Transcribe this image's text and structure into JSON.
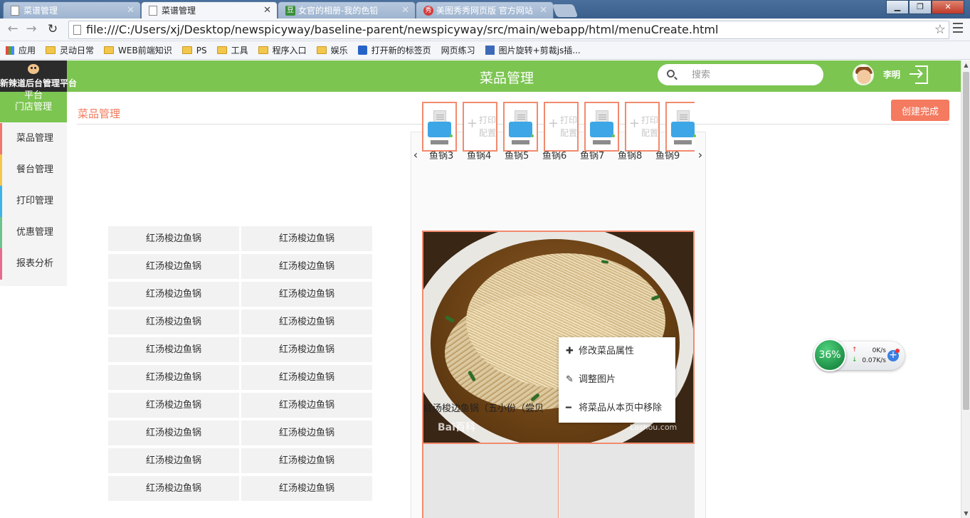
{
  "browser": {
    "tabs": [
      {
        "title": "菜谱管理",
        "icon": "page-icon"
      },
      {
        "title": "菜谱管理",
        "icon": "page-icon",
        "active": true
      },
      {
        "title": "女官的相册-我的色铅",
        "icon": "douban-icon"
      },
      {
        "title": "美图秀秀网页版 官方网站",
        "icon": "meitu-icon"
      }
    ],
    "close_glyph": "✕",
    "url": "file:///C:/Users/xj/Desktop/newspicyway/baseline-parent/newspicyway/src/main/webapp/html/menuCreate.html",
    "bookmarks": [
      {
        "label": "应用",
        "icon": "apps-icon"
      },
      {
        "label": "灵动日常",
        "icon": "folder-icon"
      },
      {
        "label": "WEB前端知识",
        "icon": "folder-icon"
      },
      {
        "label": "PS",
        "icon": "folder-icon"
      },
      {
        "label": "工具",
        "icon": "folder-icon"
      },
      {
        "label": "程序入口",
        "icon": "folder-icon"
      },
      {
        "label": "娱乐",
        "icon": "folder-icon"
      },
      {
        "label": "打开新的标签页",
        "icon": "paw-icon"
      },
      {
        "label": "网页练习",
        "icon": "page-icon"
      },
      {
        "label": "图片旋转+剪裁js插...",
        "icon": "image-icon"
      }
    ]
  },
  "app": {
    "brand": "新辣道后台管理平台",
    "title": "菜品管理",
    "search_placeholder": "搜索",
    "user": "李明"
  },
  "sidebar": {
    "active": [
      "平台",
      "门店管理"
    ],
    "items": [
      "菜品管理",
      "餐台管理",
      "打印管理",
      "优惠管理",
      "报表分析"
    ],
    "item_colors": [
      "#f0766b",
      "#f5c64a",
      "#3bb3e8",
      "#6bc48a",
      "#e86b8f"
    ]
  },
  "content": {
    "section_title": "菜品管理",
    "create_button": "创建完成"
  },
  "dishes": [
    "红汤梭边鱼锅",
    "红汤梭边鱼锅",
    "红汤梭边鱼锅",
    "红汤梭边鱼锅",
    "红汤梭边鱼锅",
    "红汤梭边鱼锅",
    "红汤梭边鱼锅",
    "红汤梭边鱼锅",
    "红汤梭边鱼锅",
    "红汤梭边鱼锅",
    "红汤梭边鱼锅",
    "红汤梭边鱼锅",
    "红汤梭边鱼锅",
    "红汤梭边鱼锅",
    "红汤梭边鱼锅",
    "红汤梭边鱼锅",
    "红汤梭边鱼锅",
    "红汤梭边鱼锅",
    "红汤梭边鱼锅",
    "红汤梭边鱼锅"
  ],
  "categories": [
    "鱼锅3",
    "鱼锅4",
    "鱼锅5",
    "鱼锅6",
    "鱼锅7",
    "鱼锅8",
    "鱼锅9"
  ],
  "print_config": {
    "add_label_1": "打印",
    "add_label_2": "配置",
    "slots": [
      "printer",
      "add",
      "printer",
      "add",
      "printer",
      "add",
      "printer"
    ]
  },
  "photo": {
    "caption": "红汤梭边鱼锅（五小份（尝贝",
    "watermark_left": "Bai百科",
    "watermark_right": "Lashou.com"
  },
  "context_menu": [
    {
      "label": "修改菜品属性",
      "icon": "plus-icon",
      "glyph": "✚"
    },
    {
      "label": "调整图片",
      "icon": "edit-icon",
      "glyph": "✎"
    },
    {
      "label": "将菜品从本页中移除",
      "icon": "minus-icon",
      "glyph": "━"
    }
  ],
  "net_widget": {
    "percent": "36%",
    "up": "0K/s",
    "down": "0.07K/s"
  }
}
